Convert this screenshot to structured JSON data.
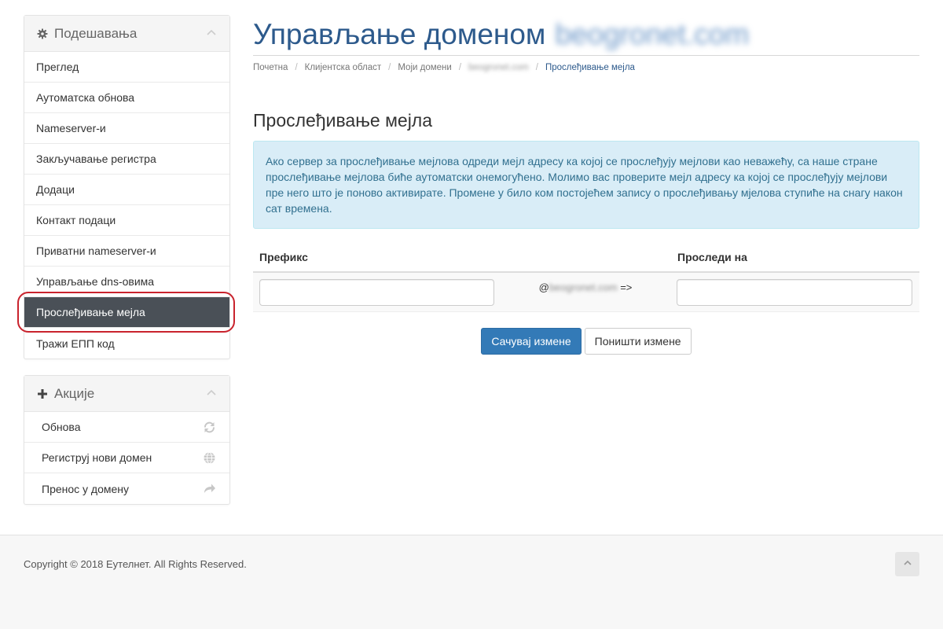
{
  "sidebar": {
    "settings": {
      "title": "Подешавања",
      "items": [
        {
          "label": "Преглед"
        },
        {
          "label": "Аутоматска обнова"
        },
        {
          "label": "Nameserver-и"
        },
        {
          "label": "Закључавање регистра"
        },
        {
          "label": "Додаци"
        },
        {
          "label": "Контакт подаци"
        },
        {
          "label": "Приватни nameserver-и"
        },
        {
          "label": "Управљање dns-овима"
        },
        {
          "label": "Прослеђивање мејла"
        },
        {
          "label": "Тражи ЕПП код"
        }
      ]
    },
    "actions": {
      "title": "Акције",
      "items": [
        {
          "label": "Обнова",
          "icon": "refresh-icon"
        },
        {
          "label": "Региструј нови домен",
          "icon": "globe-icon"
        },
        {
          "label": "Пренос у домену",
          "icon": "share-icon"
        }
      ]
    }
  },
  "header": {
    "title": "Управљање доменом",
    "domain": "beogronet.com"
  },
  "breadcrumb": {
    "home": "Почетна",
    "client_area": "Клијентска област",
    "my_domains": "Моји домени",
    "domain": "beogronet.com",
    "current": "Прослеђивање мејла"
  },
  "main": {
    "section_title": "Прослеђивање мејла",
    "alert": "Ако сервер за прослеђивање мејлова одреди мејл адресу ка којој се прослеђују мејлови као неважећу, са наше стране прослеђивање мејлова биће аутоматски онемогућено. Молимо вас проверите мејл адресу ка којој се прослеђују мејлови пре него што је поново активирате. Промене у било ком постојећем запису о прослеђивању мјелова ступиће на снагу након сат времена.",
    "table": {
      "col_prefix": "Префикс",
      "col_forward": "Проследи на",
      "at": "@",
      "domain": "beogronet.com",
      "arrow": "=>",
      "prefix_value": "",
      "forward_value": ""
    },
    "save_label": "Сачувај измене",
    "cancel_label": "Поништи измене"
  },
  "footer": {
    "copyright": "Copyright © 2018 Еутелнет. All Rights Reserved."
  },
  "colors": {
    "title": "#2d5a8c",
    "active_menu_bg": "#4a5057",
    "primary_button": "#337ab7",
    "alert_bg": "#d9edf7",
    "highlight_ring": "#c9232d"
  }
}
